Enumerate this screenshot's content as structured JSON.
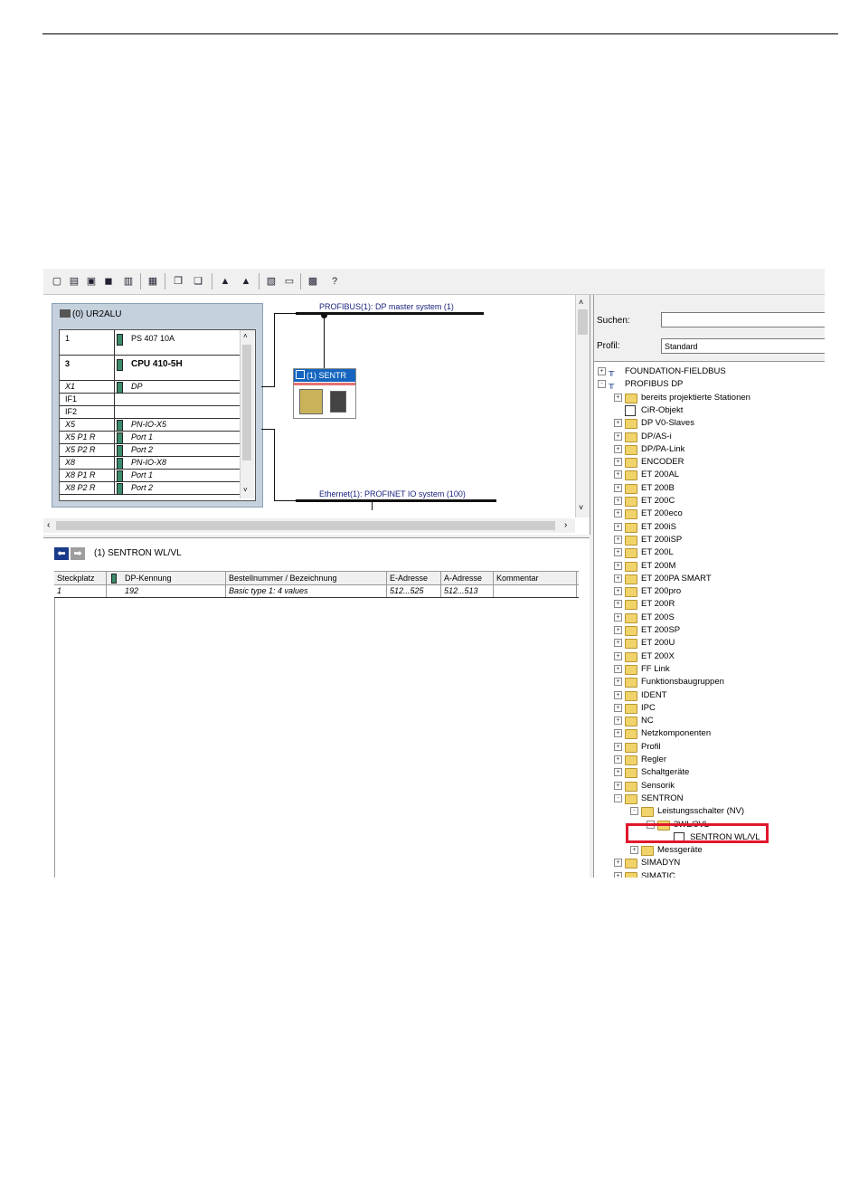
{
  "toolbar": {
    "icons": [
      "new-icon",
      "open-icon",
      "save-icon",
      "save-compile-icon",
      "download-icon",
      "print-icon",
      "copy-icon",
      "paste-icon",
      "catalog-station-icon",
      "catalog-network-icon",
      "hardware-catalog-icon",
      "configure-icon",
      "netpro-icon",
      "help-icon"
    ]
  },
  "station": {
    "title": "(0) UR2ALU",
    "rows": [
      {
        "slot": "1",
        "module": "PS 407 10A",
        "italic": false
      },
      {
        "slot": "3",
        "module": "CPU 410-5H",
        "italic": false,
        "bold": true
      },
      {
        "slot": "X1",
        "module": "DP",
        "italic": true
      },
      {
        "slot": "IF1",
        "module": "",
        "italic": false
      },
      {
        "slot": "IF2",
        "module": "",
        "italic": false
      },
      {
        "slot": "X5",
        "module": "PN-IO-X5",
        "italic": true
      },
      {
        "slot": "X5 P1 R",
        "module": "Port 1",
        "italic": true
      },
      {
        "slot": "X5 P2 R",
        "module": "Port 2",
        "italic": true
      },
      {
        "slot": "X8",
        "module": "PN-IO-X8",
        "italic": true
      },
      {
        "slot": "X8 P1 R",
        "module": "Port 1",
        "italic": true
      },
      {
        "slot": "X8 P2 R",
        "module": "Port 2",
        "italic": true
      }
    ]
  },
  "network": {
    "profibus_label": "PROFIBUS(1): DP master system (1)",
    "ethernet_label": "Ethernet(1): PROFINET IO system (100)",
    "slave_title": "(1) SENTR"
  },
  "detail": {
    "title": "(1)  SENTRON WL/VL",
    "columns": [
      "Steckplatz",
      "DP-Kennung",
      "Bestellnummer / Bezeichnung",
      "E-Adresse",
      "A-Adresse",
      "Kommentar"
    ],
    "rows": [
      {
        "slot": "1",
        "dp": "192",
        "order": "Basic type 1: 4 values",
        "e": "512...525",
        "a": "512...513",
        "comment": ""
      }
    ]
  },
  "catalog": {
    "search_label": "Suchen:",
    "search_value": "",
    "profile_label": "Profil:",
    "profile_value": "Standard",
    "tree": [
      {
        "label": "FOUNDATION-FIELDBUS",
        "level": 0,
        "icon": "bus",
        "exp": "+"
      },
      {
        "label": "PROFIBUS DP",
        "level": 0,
        "icon": "bus",
        "exp": "-"
      },
      {
        "label": "bereits projektierte Stationen",
        "level": 1,
        "icon": "folder",
        "exp": "+"
      },
      {
        "label": "CiR-Objekt",
        "level": 1,
        "icon": "doc",
        "exp": ""
      },
      {
        "label": "DP V0-Slaves",
        "level": 1,
        "icon": "folder",
        "exp": "+"
      },
      {
        "label": "DP/AS-i",
        "level": 1,
        "icon": "folder",
        "exp": "+"
      },
      {
        "label": "DP/PA-Link",
        "level": 1,
        "icon": "folder",
        "exp": "+"
      },
      {
        "label": "ENCODER",
        "level": 1,
        "icon": "folder",
        "exp": "+"
      },
      {
        "label": "ET 200AL",
        "level": 1,
        "icon": "folder",
        "exp": "+"
      },
      {
        "label": "ET 200B",
        "level": 1,
        "icon": "folder",
        "exp": "+"
      },
      {
        "label": "ET 200C",
        "level": 1,
        "icon": "folder",
        "exp": "+"
      },
      {
        "label": "ET 200eco",
        "level": 1,
        "icon": "folder",
        "exp": "+"
      },
      {
        "label": "ET 200iS",
        "level": 1,
        "icon": "folder",
        "exp": "+"
      },
      {
        "label": "ET 200iSP",
        "level": 1,
        "icon": "folder",
        "exp": "+"
      },
      {
        "label": "ET 200L",
        "level": 1,
        "icon": "folder",
        "exp": "+"
      },
      {
        "label": "ET 200M",
        "level": 1,
        "icon": "folder",
        "exp": "+"
      },
      {
        "label": "ET 200PA SMART",
        "level": 1,
        "icon": "folder",
        "exp": "+"
      },
      {
        "label": "ET 200pro",
        "level": 1,
        "icon": "folder",
        "exp": "+"
      },
      {
        "label": "ET 200R",
        "level": 1,
        "icon": "folder",
        "exp": "+"
      },
      {
        "label": "ET 200S",
        "level": 1,
        "icon": "folder",
        "exp": "+"
      },
      {
        "label": "ET 200SP",
        "level": 1,
        "icon": "folder",
        "exp": "+"
      },
      {
        "label": "ET 200U",
        "level": 1,
        "icon": "folder",
        "exp": "+"
      },
      {
        "label": "ET 200X",
        "level": 1,
        "icon": "folder",
        "exp": "+"
      },
      {
        "label": "FF Link",
        "level": 1,
        "icon": "folder",
        "exp": "+"
      },
      {
        "label": "Funktionsbaugruppen",
        "level": 1,
        "icon": "folder",
        "exp": "+"
      },
      {
        "label": "IDENT",
        "level": 1,
        "icon": "folder",
        "exp": "+"
      },
      {
        "label": "IPC",
        "level": 1,
        "icon": "folder",
        "exp": "+"
      },
      {
        "label": "NC",
        "level": 1,
        "icon": "folder",
        "exp": "+"
      },
      {
        "label": "Netzkomponenten",
        "level": 1,
        "icon": "folder",
        "exp": "+"
      },
      {
        "label": "Profil",
        "level": 1,
        "icon": "folder",
        "exp": "+"
      },
      {
        "label": "Regler",
        "level": 1,
        "icon": "folder",
        "exp": "+"
      },
      {
        "label": "Schaltgeräte",
        "level": 1,
        "icon": "folder",
        "exp": "+"
      },
      {
        "label": "Sensorik",
        "level": 1,
        "icon": "folder",
        "exp": "+"
      },
      {
        "label": "SENTRON",
        "level": 1,
        "icon": "folder",
        "exp": "-"
      },
      {
        "label": "Leistungsschalter (NV)",
        "level": 2,
        "icon": "folder",
        "exp": "-"
      },
      {
        "label": "3WL/3VL",
        "level": 3,
        "icon": "folder",
        "exp": "-"
      },
      {
        "label": "SENTRON WL/VL",
        "level": 4,
        "icon": "doc",
        "exp": ""
      },
      {
        "label": "Messgeräte",
        "level": 2,
        "icon": "folder",
        "exp": "+"
      },
      {
        "label": "SIMADYN",
        "level": 1,
        "icon": "folder",
        "exp": "+"
      },
      {
        "label": "SIMATIC",
        "level": 1,
        "icon": "folder",
        "exp": "+"
      }
    ]
  },
  "colors": {
    "highlight": "#e0182d",
    "station_bg": "#c5d1dd",
    "bus_label": "#1a237e",
    "folder": "#f1d36b"
  }
}
